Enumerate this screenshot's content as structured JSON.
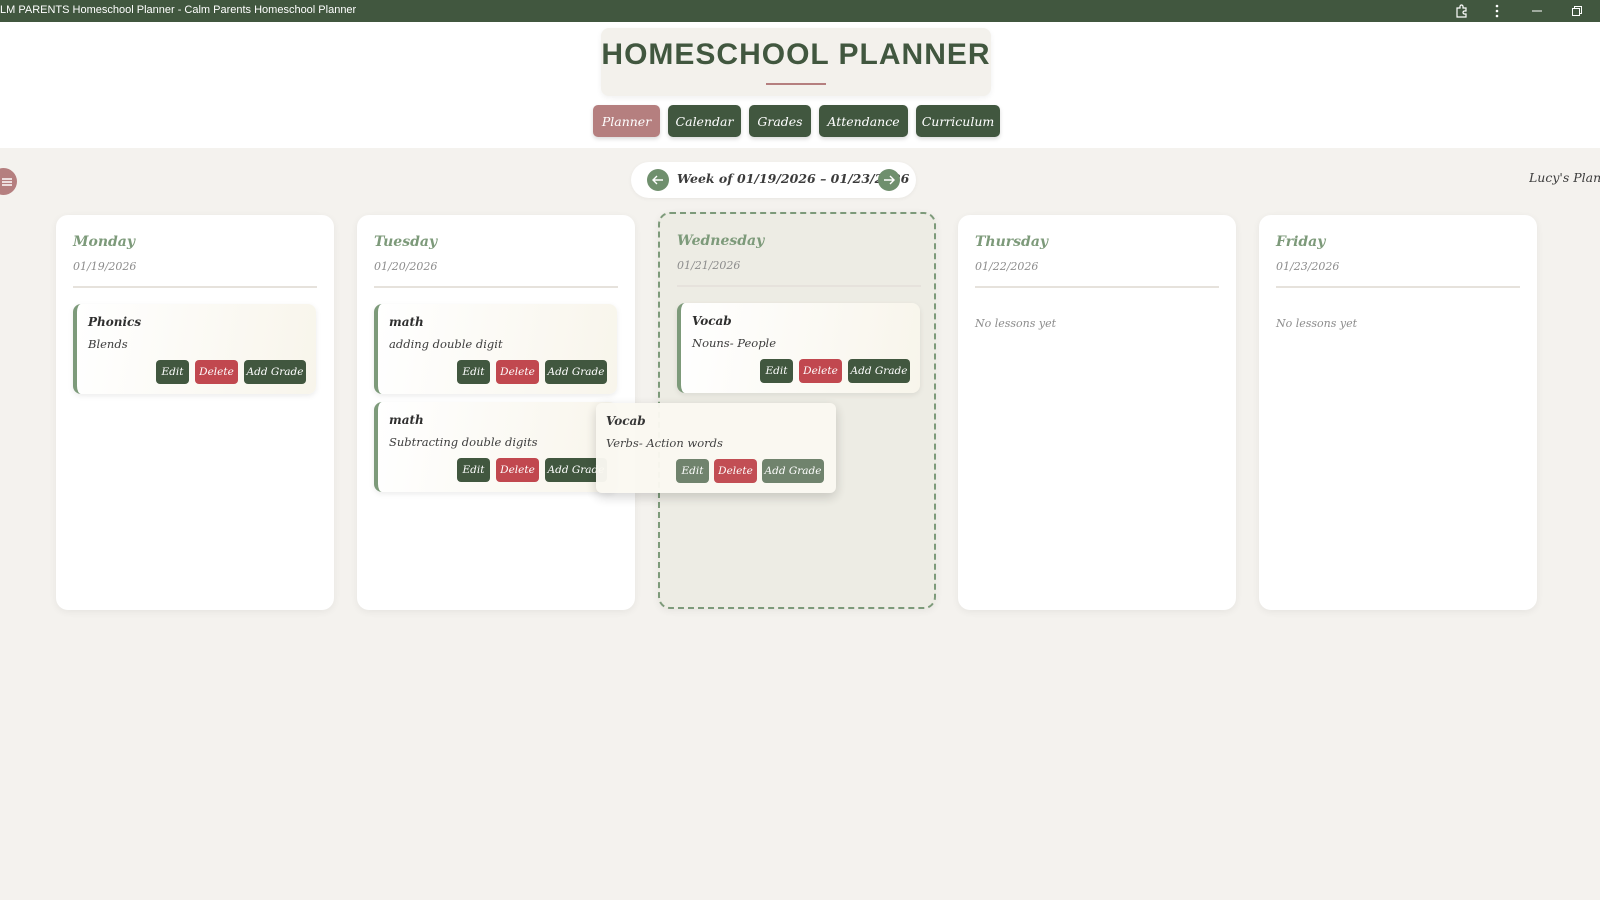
{
  "window": {
    "title": "LM PARENTS Homeschool Planner - Calm Parents Homeschool Planner"
  },
  "header": {
    "title": "HOMESCHOOL PLANNER",
    "tabs": [
      {
        "label": "Planner",
        "active": true
      },
      {
        "label": "Calendar",
        "active": false
      },
      {
        "label": "Grades",
        "active": false
      },
      {
        "label": "Attendance",
        "active": false
      },
      {
        "label": "Curriculum",
        "active": false
      }
    ]
  },
  "week": {
    "label": "Week of 01/19/2026 – 01/23/2026",
    "planner_name": "Lucy's Planner",
    "prev_icon": "arrow-left-icon",
    "next_icon": "arrow-right-icon"
  },
  "buttons": {
    "edit": "Edit",
    "delete": "Delete",
    "add_grade": "Add Grade"
  },
  "days": [
    {
      "name": "Monday",
      "date": "01/19/2026",
      "empty_text": "",
      "lessons": [
        {
          "subject": "Phonics",
          "topic": "Blends"
        }
      ]
    },
    {
      "name": "Tuesday",
      "date": "01/20/2026",
      "empty_text": "",
      "lessons": [
        {
          "subject": "math",
          "topic": "adding double digit"
        },
        {
          "subject": "math",
          "topic": "Subtracting double digits"
        }
      ]
    },
    {
      "name": "Wednesday",
      "date": "01/21/2026",
      "empty_text": "",
      "lessons": [
        {
          "subject": "Vocab",
          "topic": "Nouns- People"
        }
      ]
    },
    {
      "name": "Thursday",
      "date": "01/22/2026",
      "empty_text": "No lessons yet",
      "lessons": []
    },
    {
      "name": "Friday",
      "date": "01/23/2026",
      "empty_text": "No lessons yet",
      "lessons": []
    }
  ],
  "dragging_lesson": {
    "subject": "Vocab",
    "topic": "Verbs- Action words"
  },
  "colors": {
    "primary_green": "#41573f",
    "accent_rose": "#b57f7f",
    "delete_red": "#c1484f",
    "sage": "#7d9a7a",
    "background": "#f4f2ee"
  }
}
